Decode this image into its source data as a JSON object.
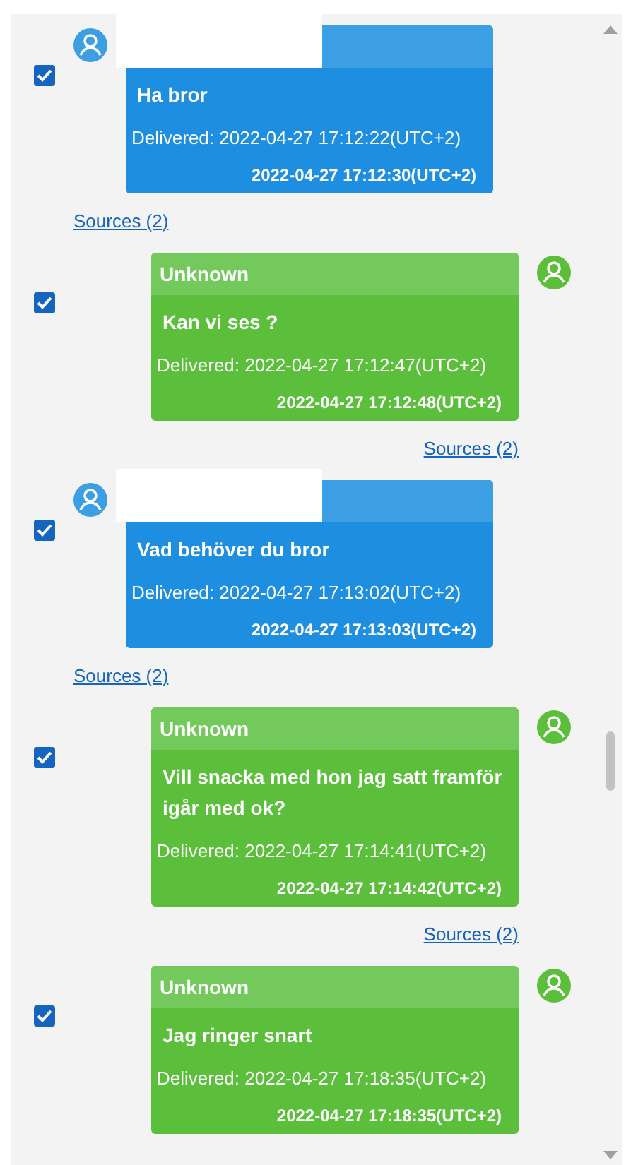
{
  "messages": [
    {
      "kind": "incoming",
      "checked": true,
      "text": "Ha bror",
      "delivered": "Delivered: 2022-04-27 17:12:22(UTC+2)",
      "timestamp": "2022-04-27 17:12:30(UTC+2)",
      "sources": "Sources (2)"
    },
    {
      "kind": "outgoing",
      "checked": true,
      "sender": "Unknown",
      "text": "Kan vi ses ?",
      "delivered": "Delivered: 2022-04-27 17:12:47(UTC+2)",
      "timestamp": "2022-04-27 17:12:48(UTC+2)",
      "sources": "Sources (2)"
    },
    {
      "kind": "incoming",
      "checked": true,
      "text": "Vad behöver du bror",
      "delivered": "Delivered: 2022-04-27 17:13:02(UTC+2)",
      "timestamp": "2022-04-27 17:13:03(UTC+2)",
      "sources": "Sources (2)"
    },
    {
      "kind": "outgoing",
      "checked": true,
      "sender": "Unknown",
      "text": "Vill snacka med hon jag satt framför igår med ok?",
      "delivered": "Delivered: 2022-04-27 17:14:41(UTC+2)",
      "timestamp": "2022-04-27 17:14:42(UTC+2)",
      "sources": "Sources (2)"
    },
    {
      "kind": "outgoing",
      "checked": true,
      "sender": "Unknown",
      "text": "Jag ringer snart",
      "delivered": "Delivered: 2022-04-27 17:18:35(UTC+2)",
      "timestamp": "2022-04-27 17:18:35(UTC+2)"
    }
  ]
}
